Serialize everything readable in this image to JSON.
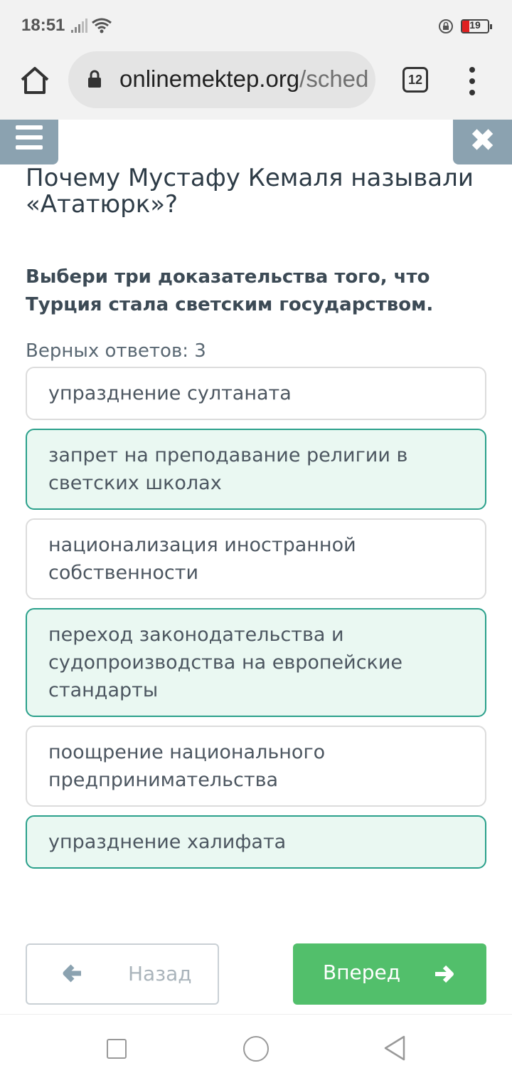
{
  "status_bar": {
    "time": "18:51",
    "battery": "19"
  },
  "browser": {
    "url_domain": "onlinemektep.org",
    "url_path": "/sched",
    "tab_count": "12"
  },
  "question": {
    "title": "Почему Мустафу Кемаля называли «Ататюрк»?",
    "instruction": "Выбери три доказательства того, что Турция стала светским государством.",
    "answer_count": "Верных ответов: 3"
  },
  "options": [
    {
      "text": "упразднение султаната",
      "selected": false
    },
    {
      "text": "запрет на преподавание религии в светских школах",
      "selected": true
    },
    {
      "text": "национализация иностранной собственности",
      "selected": false
    },
    {
      "text": "переход законодательства и судопроизводства на европейские стандарты",
      "selected": true
    },
    {
      "text": "поощрение национального предпринимательства",
      "selected": false
    },
    {
      "text": "упразднение халифата",
      "selected": true
    }
  ],
  "navigation": {
    "back_label": "Назад",
    "next_label": "Вперед"
  },
  "colors": {
    "accent_green": "#52bf6b",
    "selected_bg": "#eaf8f2",
    "selected_border": "#2aa08b",
    "toolbar_btn": "#8ba2b0"
  }
}
